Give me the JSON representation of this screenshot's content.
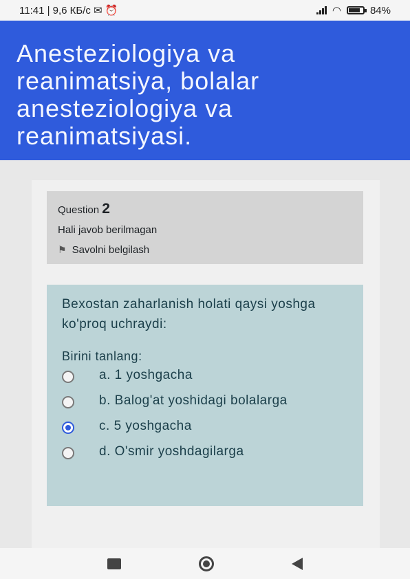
{
  "status_bar": {
    "time_info": "11:41 | 9,6 КБ/с",
    "battery": "84%"
  },
  "header": {
    "title": "Anesteziologiya va reanimatsiya, bolalar anesteziologiya va reanimatsiyasi."
  },
  "question_info": {
    "label": "Question",
    "number": "2",
    "state": "Hali javob berilmagan",
    "flag_label": "Savolni belgilash"
  },
  "question": {
    "text": "Bexostan zaharlanish holati qaysi yoshga ko'proq uchraydi:",
    "prompt": "Birini tanlang:",
    "options": [
      {
        "letter": "a.",
        "text": "1 yoshgacha",
        "selected": false
      },
      {
        "letter": "b.",
        "text": "Balog'at yoshidagi bolalarga",
        "selected": false
      },
      {
        "letter": "c.",
        "text": "5 yoshgacha",
        "selected": true
      },
      {
        "letter": "d.",
        "text": "O'smir yoshdagilarga",
        "selected": false
      }
    ]
  },
  "colors": {
    "header_bg": "#2f5bdc",
    "formulation_bg": "#bcd4d7",
    "info_bg": "#d4d4d4"
  }
}
